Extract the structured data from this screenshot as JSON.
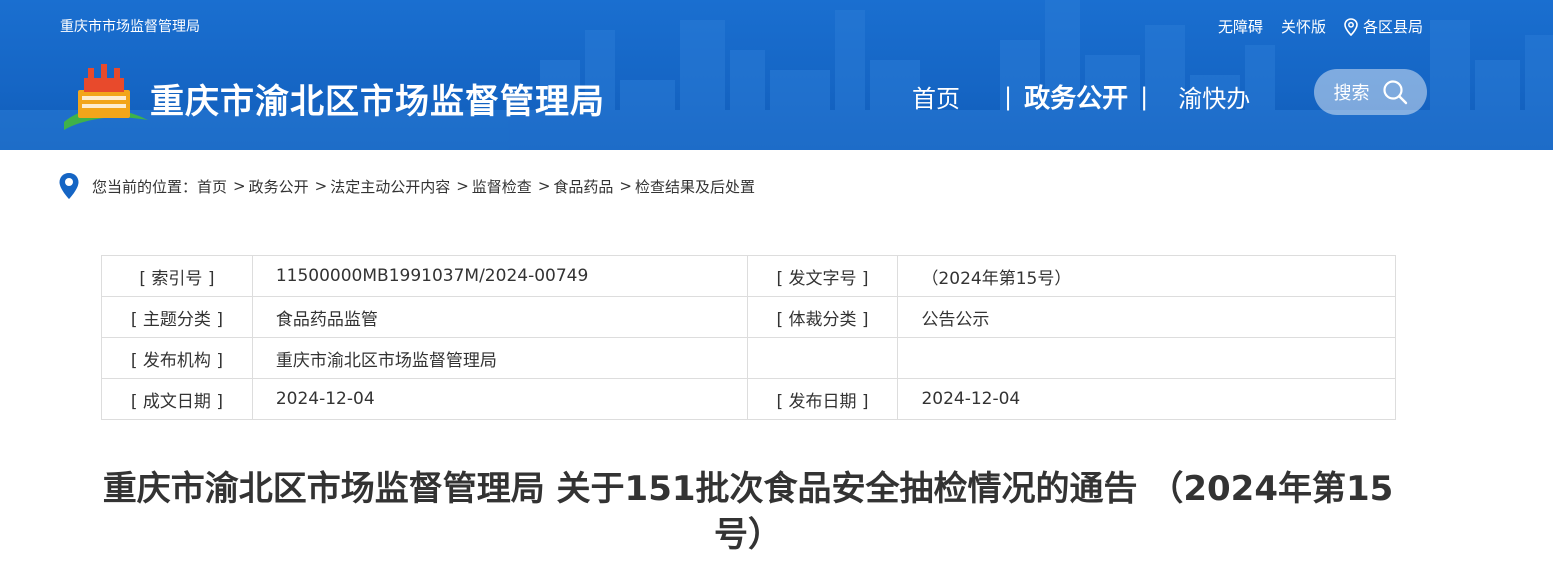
{
  "topbar": {
    "org_name": "重庆市市场监督管理局",
    "links": [
      "无障碍",
      "关怀版",
      "各区县局"
    ]
  },
  "header": {
    "site_title": "重庆市渝北区市场监督管理局",
    "nav": [
      "首页",
      "政务公开",
      "渝快办"
    ],
    "search_label": "搜索"
  },
  "breadcrumb": {
    "prefix": "您当前的位置：",
    "items": [
      "首页",
      "政务公开",
      "法定主动公开内容",
      "监督检查",
      "食品药品",
      "检查结果及后处置"
    ]
  },
  "meta": {
    "rows": [
      {
        "label1": "[ 索引号 ]",
        "value1": "11500000MB1991037M/2024-00749",
        "label2": "[ 发文字号 ]",
        "value2": "（2024年第15号）"
      },
      {
        "label1": "[ 主题分类 ]",
        "value1": "食品药品监管",
        "label2": "[ 体裁分类 ]",
        "value2": "公告公示"
      },
      {
        "label1": "[ 发布机构 ]",
        "value1": "重庆市渝北区市场监督管理局",
        "label2": "",
        "value2": ""
      },
      {
        "label1": "[ 成文日期 ]",
        "value1": "2024-12-04",
        "label2": "[ 发布日期 ]",
        "value2": "2024-12-04"
      }
    ]
  },
  "article": {
    "title": "重庆市渝北区市场监督管理局 关于151批次食品安全抽检情况的通告 （2024年第15号）"
  },
  "colors": {
    "header_blue": "#1565c4",
    "text": "#333333",
    "border": "#dddddd"
  }
}
